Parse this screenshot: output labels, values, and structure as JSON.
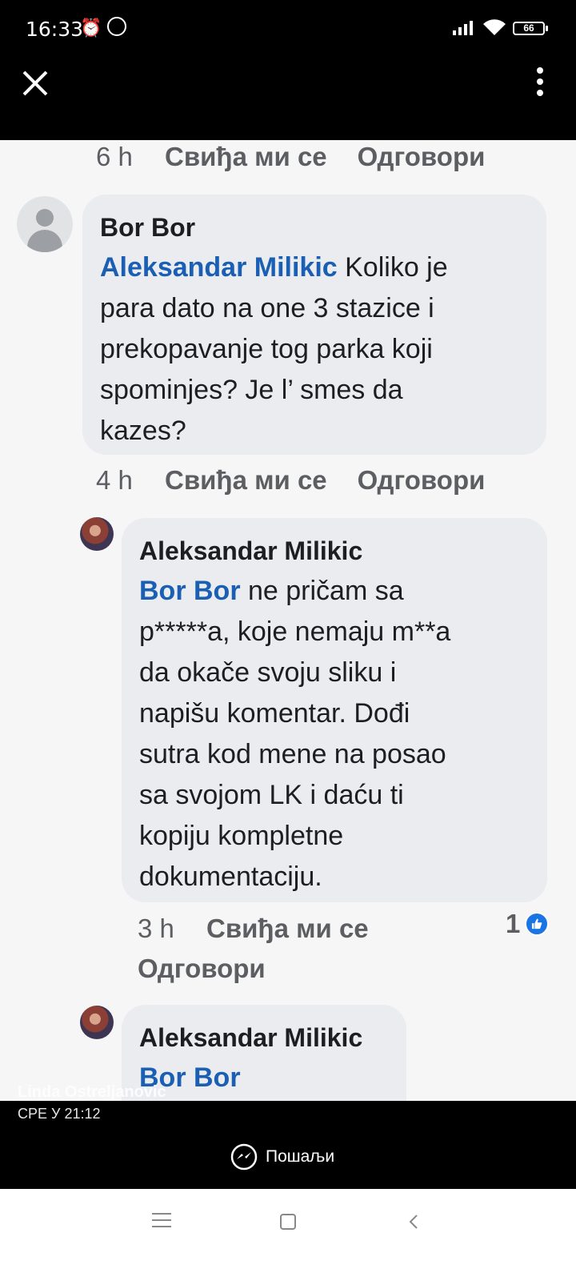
{
  "status_bar": {
    "time": "16:33",
    "battery": "66"
  },
  "comment_thread": {
    "top_meta": {
      "time": "6 h",
      "like": "Свиђа ми се",
      "reply": "Одговори"
    },
    "comment1": {
      "author": "Bor Bor",
      "mention": "Aleksandar Milikic",
      "text": " Koliko je\npara dato na one 3 stazice i\nprekopavanje tog parka koji\nspominjes? Je l’ smes da\nkazes?",
      "time": "4 h",
      "like": "Свиђа ми се",
      "reply": "Одговори"
    },
    "comment2": {
      "author": "Aleksandar Milikic",
      "mention": "Bor Bor",
      "text": " ne pričam sa\np*****a, koje nemaju m**a\nda okače svoju sliku i\nnapišu komentar.  Dođi\nsutra kod mene na posao\nsa svojom LK i daću ti\nkopiju kompletne\ndokumentaciju.",
      "time": "3 h",
      "like": "Свиђа ми се",
      "reply": "Одговори",
      "like_count": "1"
    },
    "comment3": {
      "author": "Aleksandar Milikic",
      "mention": "Bor Bor"
    }
  },
  "caption": {
    "name": "Linda Ostreljanovic",
    "date": "СРЕ У 21:12"
  },
  "actions": {
    "send_label": "Пошаљи"
  }
}
